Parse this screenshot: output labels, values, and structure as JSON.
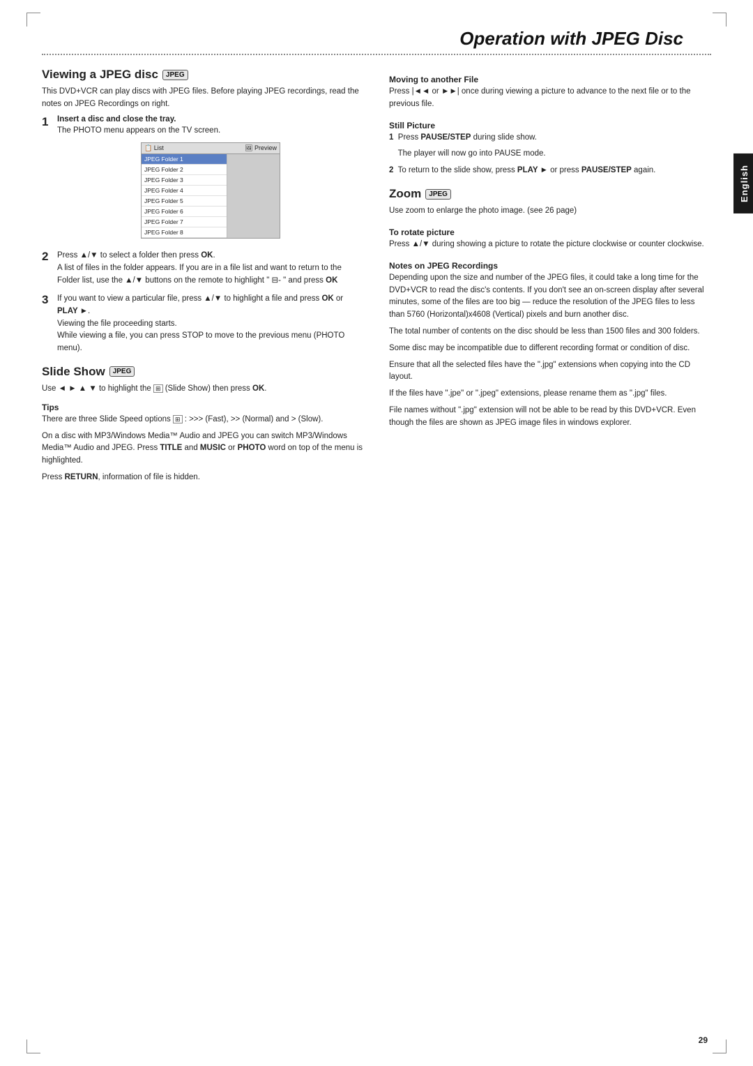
{
  "page": {
    "title": "Operation with JPEG Disc",
    "page_number": "29",
    "english_tab": "English"
  },
  "left_column": {
    "section_title": "Viewing a JPEG disc",
    "section_badge": "JPEG",
    "intro_text": "This DVD+VCR can play discs with JPEG files. Before playing JPEG recordings, read the notes on JPEG Recordings on right.",
    "steps": [
      {
        "number": "1",
        "heading": "Insert a disc and close the tray.",
        "body": "The PHOTO menu appears on the TV screen."
      },
      {
        "number": "2",
        "body": "Press ▲/▼ to select a folder then press OK. A list of files in the folder appears. If you are in a file list and want to return to the Folder list, use the ▲/▼ buttons on the remote to highlight \" ⊟- \" and press OK"
      },
      {
        "number": "3",
        "body": "If you want to view a particular file, press ▲/▼ to highlight a file and press OK or PLAY ►.\nViewing the file proceeding starts.\nWhile viewing a file, you can press STOP to move to the previous menu (PHOTO menu)."
      }
    ],
    "slideshow": {
      "title": "Slide Show",
      "badge": "JPEG",
      "body": "Use ◄ ► ▲ ▼ to highlight the 🎞 (Slide Show) then press OK."
    },
    "tips": {
      "title": "Tips",
      "items": [
        "There are three Slide Speed options 🎞 : >>> (Fast), >> (Normal) and > (Slow).",
        "On a disc with MP3/Windows Media™ Audio and JPEG you can switch MP3/Windows Media™ Audio and JPEG. Press TITLE and MUSIC or PHOTO word on top of the menu is highlighted.",
        "Press RETURN, information of file is hidden."
      ]
    },
    "mockup": {
      "header_left": "📋 List",
      "header_right": "🖼 Preview",
      "folders": [
        "JPEG Folder 1",
        "JPEG Folder 2",
        "JPEG Folder 3",
        "JPEG Folder 4",
        "JPEG Folder 5",
        "JPEG Folder 6",
        "JPEG Folder 7",
        "JPEG Folder 8"
      ]
    }
  },
  "right_column": {
    "moving_to_another_file": {
      "title": "Moving to another File",
      "body": "Press |◄◄ or ►►| once during viewing a picture to advance to the next file or to the previous file."
    },
    "still_picture": {
      "title": "Still Picture",
      "steps": [
        "Press PAUSE/STEP during slide show.",
        "The player will now go into PAUSE mode.",
        "To return to the slide show, press PLAY ► or press PAUSE/STEP again."
      ]
    },
    "zoom": {
      "title": "Zoom",
      "badge": "JPEG",
      "body": "Use zoom to enlarge the photo image. (see 26 page)"
    },
    "rotate": {
      "title": "To rotate picture",
      "body": "Press ▲/▼ during showing a picture to rotate the picture clockwise or counter clockwise."
    },
    "notes": {
      "title": "Notes on JPEG Recordings",
      "items": [
        "Depending upon the size and number of the JPEG files, it could take a long time for the DVD+VCR to read the disc's contents. If you don't see an on-screen display after several minutes, some of the files are too big — reduce the resolution of the JPEG files to less than 5760 (Horizontal)x4608 (Vertical) pixels and burn another disc.",
        "The total number of contents on the disc should be less than 1500 files and 300 folders.",
        "Some disc may be incompatible due to different recording format or condition of disc.",
        "Ensure that all the selected files have the \".jpg\" extensions when copying into the CD layout.",
        "If the files have \".jpe\" or \".jpeg\" extensions, please rename them as \".jpg\" files.",
        "File names without \".jpg\" extension will not be able to be read by this DVD+VCR. Even though the files are shown as JPEG image files in windows explorer."
      ]
    }
  }
}
